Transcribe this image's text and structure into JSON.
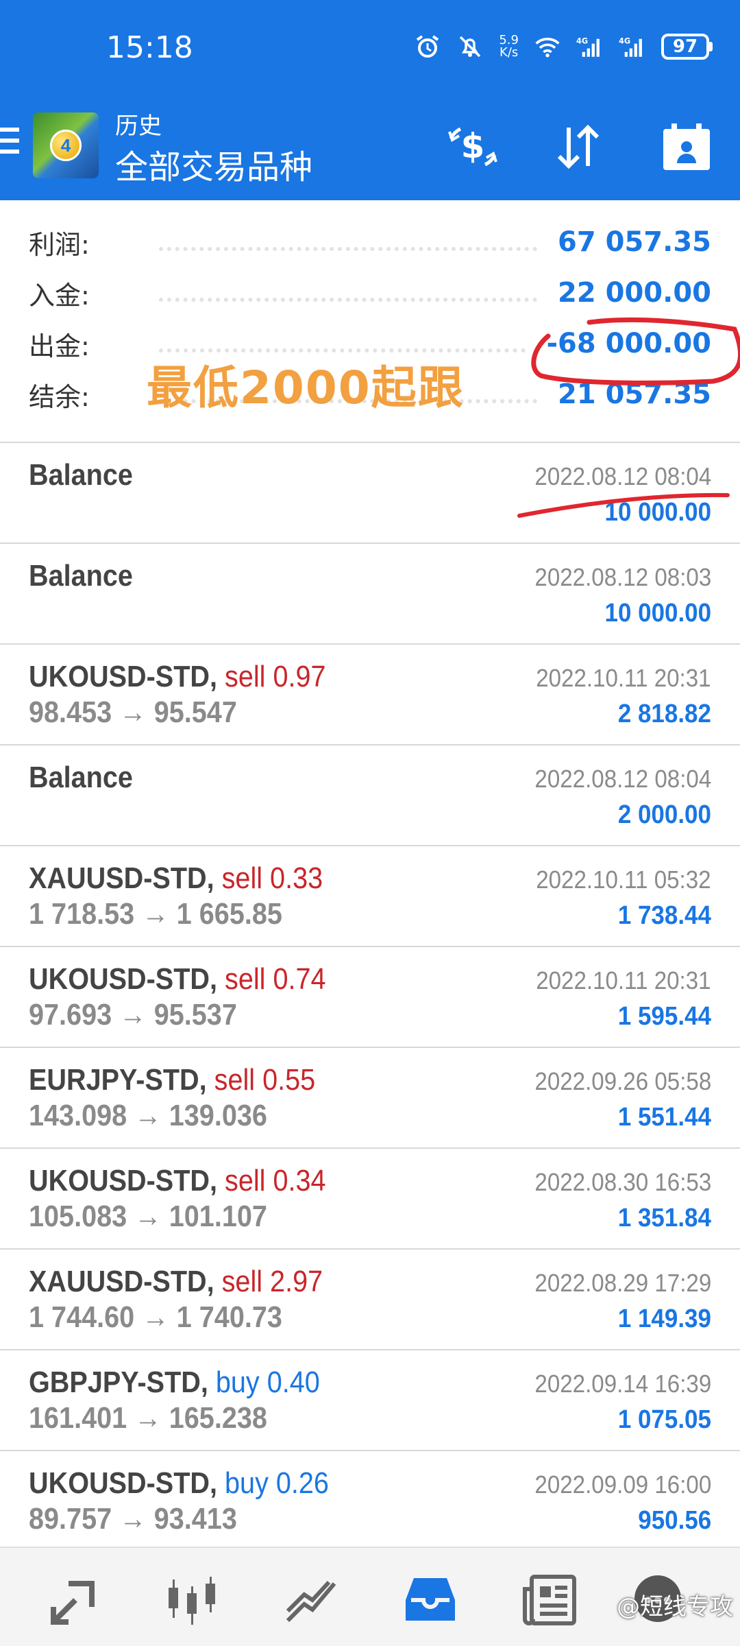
{
  "status_bar": {
    "time": "15:18",
    "net_speed_value": "5.9",
    "net_speed_unit": "K/s",
    "network_1": "4G",
    "network_2": "4G",
    "battery": "97"
  },
  "app_bar": {
    "subtitle": "历史",
    "title": "全部交易品种",
    "icons": [
      "dollar-swap-icon",
      "sort-icon",
      "calendar-icon"
    ]
  },
  "summary": [
    {
      "label": "利润:",
      "value": "67 057.35"
    },
    {
      "label": "入金:",
      "value": "22 000.00"
    },
    {
      "label": "出金:",
      "value": "-68 000.00"
    },
    {
      "label": "结余:",
      "value": "21 057.35"
    }
  ],
  "overlay_text": "最低2000起跟",
  "trades": [
    {
      "symbol": "Balance",
      "side": "",
      "side_type": "",
      "prices": "",
      "time": "2022.08.12 08:04",
      "profit": "10 000.00"
    },
    {
      "symbol": "Balance",
      "side": "",
      "side_type": "",
      "prices": "",
      "time": "2022.08.12 08:03",
      "profit": "10 000.00"
    },
    {
      "symbol": "UKOUSD-STD,",
      "side": "sell 0.97",
      "side_type": "sell",
      "prices": "98.453 → 95.547",
      "time": "2022.10.11 20:31",
      "profit": "2 818.82"
    },
    {
      "symbol": "Balance",
      "side": "",
      "side_type": "",
      "prices": "",
      "time": "2022.08.12 08:04",
      "profit": "2 000.00"
    },
    {
      "symbol": "XAUUSD-STD,",
      "side": "sell 0.33",
      "side_type": "sell",
      "prices": "1 718.53 → 1 665.85",
      "time": "2022.10.11 05:32",
      "profit": "1 738.44"
    },
    {
      "symbol": "UKOUSD-STD,",
      "side": "sell 0.74",
      "side_type": "sell",
      "prices": "97.693 → 95.537",
      "time": "2022.10.11 20:31",
      "profit": "1 595.44"
    },
    {
      "symbol": "EURJPY-STD,",
      "side": "sell 0.55",
      "side_type": "sell",
      "prices": "143.098 → 139.036",
      "time": "2022.09.26 05:58",
      "profit": "1 551.44"
    },
    {
      "symbol": "UKOUSD-STD,",
      "side": "sell 0.34",
      "side_type": "sell",
      "prices": "105.083 → 101.107",
      "time": "2022.08.30 16:53",
      "profit": "1 351.84"
    },
    {
      "symbol": "XAUUSD-STD,",
      "side": "sell 2.97",
      "side_type": "sell",
      "prices": "1 744.60 → 1 740.73",
      "time": "2022.08.29 17:29",
      "profit": "1 149.39"
    },
    {
      "symbol": "GBPJPY-STD,",
      "side": "buy 0.40",
      "side_type": "buy",
      "prices": "161.401 → 165.238",
      "time": "2022.09.14 16:39",
      "profit": "1 075.05"
    },
    {
      "symbol": "UKOUSD-STD,",
      "side": "buy 0.26",
      "side_type": "buy",
      "prices": "89.757 → 93.413",
      "time": "2022.09.09 16:00",
      "profit": "950.56"
    }
  ],
  "bottom_nav": {
    "items": [
      "quotes-icon",
      "chart-icon",
      "trade-icon",
      "history-icon",
      "news-icon",
      "chat-icon"
    ],
    "active": "history-icon"
  },
  "watermark": "@短线专攻",
  "colors": {
    "primary": "#1976e3",
    "sell": "#c8262b",
    "buy": "#1976e3",
    "muted": "#8a8a8a",
    "annotation_red": "#e0262e",
    "overlay_orange": "#f2a040"
  }
}
